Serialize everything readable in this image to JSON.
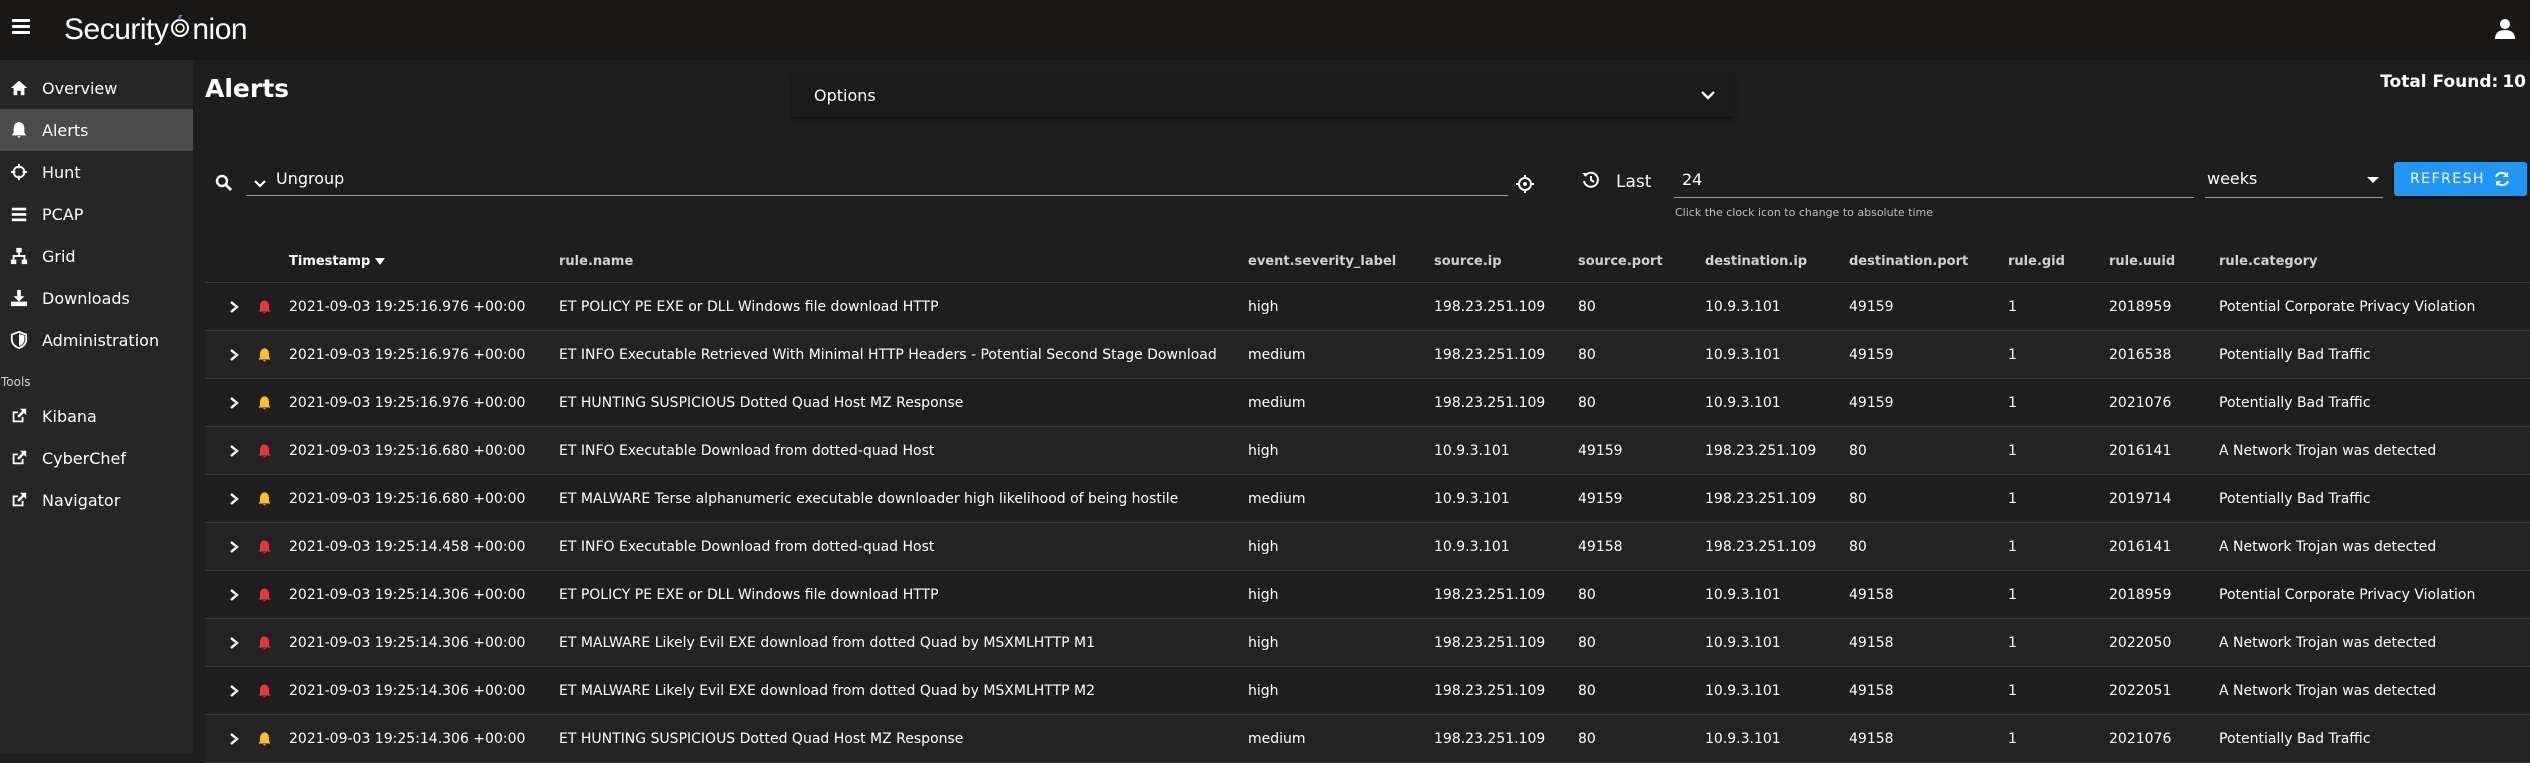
{
  "app": {
    "logo_text_pre": "Security",
    "logo_text_post": "nion"
  },
  "sidebar": {
    "items": [
      {
        "label": "Overview",
        "icon": "home-icon"
      },
      {
        "label": "Alerts",
        "icon": "bell-icon",
        "active": true
      },
      {
        "label": "Hunt",
        "icon": "crosshairs-icon"
      },
      {
        "label": "PCAP",
        "icon": "list-icon"
      },
      {
        "label": "Grid",
        "icon": "sitemap-icon"
      },
      {
        "label": "Downloads",
        "icon": "download-icon"
      },
      {
        "label": "Administration",
        "icon": "shield-icon"
      }
    ],
    "tools_label": "Tools",
    "tools": [
      {
        "label": "Kibana",
        "icon": "external-link-icon"
      },
      {
        "label": "CyberChef",
        "icon": "external-link-icon"
      },
      {
        "label": "Navigator",
        "icon": "external-link-icon"
      }
    ]
  },
  "main": {
    "title": "Alerts",
    "total_label": "Total Found:",
    "total_value": "10",
    "options_label": "Options"
  },
  "query": {
    "value": "Ungroup",
    "last_label": "Last",
    "range_value": "24",
    "range_hint": "Click the clock icon to change to absolute time",
    "unit": "weeks",
    "refresh_label": "REFRESH"
  },
  "colors": {
    "high": "#e53935",
    "medium": "#fbc02d",
    "accent": "#2196f3"
  },
  "table": {
    "headers": {
      "timestamp": "Timestamp",
      "rule_name": "rule.name",
      "severity": "event.severity_label",
      "source_ip": "source.ip",
      "source_port": "source.port",
      "destination_ip": "destination.ip",
      "destination_port": "destination.port",
      "rule_gid": "rule.gid",
      "rule_uuid": "rule.uuid",
      "rule_category": "rule.category"
    },
    "rows": [
      {
        "timestamp": "2021-09-03 19:25:16.976 +00:00",
        "rule_name": "ET POLICY PE EXE or DLL Windows file download HTTP",
        "severity": "high",
        "source_ip": "198.23.251.109",
        "source_port": "80",
        "destination_ip": "10.9.3.101",
        "destination_port": "49159",
        "rule_gid": "1",
        "rule_uuid": "2018959",
        "rule_category": "Potential Corporate Privacy Violation"
      },
      {
        "timestamp": "2021-09-03 19:25:16.976 +00:00",
        "rule_name": "ET INFO Executable Retrieved With Minimal HTTP Headers - Potential Second Stage Download",
        "severity": "medium",
        "source_ip": "198.23.251.109",
        "source_port": "80",
        "destination_ip": "10.9.3.101",
        "destination_port": "49159",
        "rule_gid": "1",
        "rule_uuid": "2016538",
        "rule_category": "Potentially Bad Traffic"
      },
      {
        "timestamp": "2021-09-03 19:25:16.976 +00:00",
        "rule_name": "ET HUNTING SUSPICIOUS Dotted Quad Host MZ Response",
        "severity": "medium",
        "source_ip": "198.23.251.109",
        "source_port": "80",
        "destination_ip": "10.9.3.101",
        "destination_port": "49159",
        "rule_gid": "1",
        "rule_uuid": "2021076",
        "rule_category": "Potentially Bad Traffic"
      },
      {
        "timestamp": "2021-09-03 19:25:16.680 +00:00",
        "rule_name": "ET INFO Executable Download from dotted-quad Host",
        "severity": "high",
        "source_ip": "10.9.3.101",
        "source_port": "49159",
        "destination_ip": "198.23.251.109",
        "destination_port": "80",
        "rule_gid": "1",
        "rule_uuid": "2016141",
        "rule_category": "A Network Trojan was detected"
      },
      {
        "timestamp": "2021-09-03 19:25:16.680 +00:00",
        "rule_name": "ET MALWARE Terse alphanumeric executable downloader high likelihood of being hostile",
        "severity": "medium",
        "source_ip": "10.9.3.101",
        "source_port": "49159",
        "destination_ip": "198.23.251.109",
        "destination_port": "80",
        "rule_gid": "1",
        "rule_uuid": "2019714",
        "rule_category": "Potentially Bad Traffic"
      },
      {
        "timestamp": "2021-09-03 19:25:14.458 +00:00",
        "rule_name": "ET INFO Executable Download from dotted-quad Host",
        "severity": "high",
        "source_ip": "10.9.3.101",
        "source_port": "49158",
        "destination_ip": "198.23.251.109",
        "destination_port": "80",
        "rule_gid": "1",
        "rule_uuid": "2016141",
        "rule_category": "A Network Trojan was detected"
      },
      {
        "timestamp": "2021-09-03 19:25:14.306 +00:00",
        "rule_name": "ET POLICY PE EXE or DLL Windows file download HTTP",
        "severity": "high",
        "source_ip": "198.23.251.109",
        "source_port": "80",
        "destination_ip": "10.9.3.101",
        "destination_port": "49158",
        "rule_gid": "1",
        "rule_uuid": "2018959",
        "rule_category": "Potential Corporate Privacy Violation"
      },
      {
        "timestamp": "2021-09-03 19:25:14.306 +00:00",
        "rule_name": "ET MALWARE Likely Evil EXE download from dotted Quad by MSXMLHTTP M1",
        "severity": "high",
        "source_ip": "198.23.251.109",
        "source_port": "80",
        "destination_ip": "10.9.3.101",
        "destination_port": "49158",
        "rule_gid": "1",
        "rule_uuid": "2022050",
        "rule_category": "A Network Trojan was detected"
      },
      {
        "timestamp": "2021-09-03 19:25:14.306 +00:00",
        "rule_name": "ET MALWARE Likely Evil EXE download from dotted Quad by MSXMLHTTP M2",
        "severity": "high",
        "source_ip": "198.23.251.109",
        "source_port": "80",
        "destination_ip": "10.9.3.101",
        "destination_port": "49158",
        "rule_gid": "1",
        "rule_uuid": "2022051",
        "rule_category": "A Network Trojan was detected"
      },
      {
        "timestamp": "2021-09-03 19:25:14.306 +00:00",
        "rule_name": "ET HUNTING SUSPICIOUS Dotted Quad Host MZ Response",
        "severity": "medium",
        "source_ip": "198.23.251.109",
        "source_port": "80",
        "destination_ip": "10.9.3.101",
        "destination_port": "49158",
        "rule_gid": "1",
        "rule_uuid": "2021076",
        "rule_category": "Potentially Bad Traffic"
      }
    ]
  }
}
